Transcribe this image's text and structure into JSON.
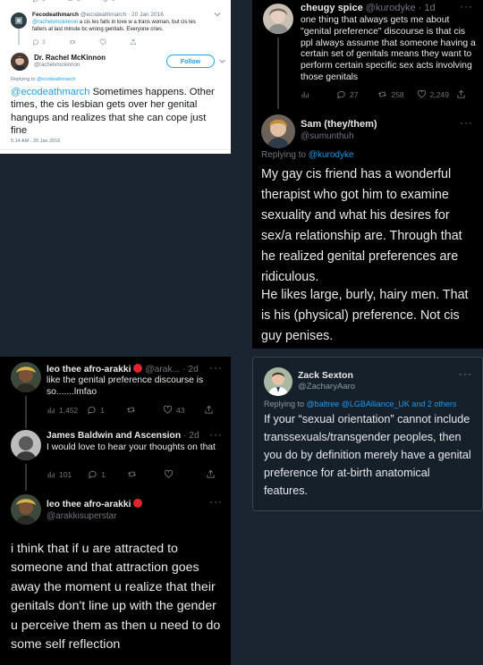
{
  "panel1": {
    "top_stats": [
      "0",
      "1",
      "3"
    ],
    "tweet1": {
      "name": "Fecodeathmarch",
      "handle": "@ecodeathmarch",
      "date": "20 Jan 2016",
      "reply_to": "@rachelvmckinnon",
      "text": "a cis les falls in love w a trans woman, but cis les falters at last minute bc wrong genitals. Everyone cries.",
      "stats": [
        "3",
        "",
        ""
      ]
    },
    "tweet2": {
      "name": "Dr. Rachel McKinnon",
      "handle": "@rachelvmckinnon",
      "follow_label": "Follow",
      "replying_label": "Replying to",
      "replying_handle": "@ecodeathmarch",
      "mention": "@ecodeathmarch",
      "text": " Sometimes happens. Other times, the cis lesbian gets over her genital hangups and realizes that she can cope just fine",
      "timestamp": "5:14 AM - 20 Jan 2016"
    }
  },
  "panel2": {
    "tweet1": {
      "name": "cheugy spice",
      "handle": "@kurodyke",
      "time": "1d",
      "text": "one thing that always gets me about \"genital preference\" discourse is that cis ppl always assume that someone having a certain set of genitals means they want to perform certain specific sex acts involving those genitals",
      "replies": "27",
      "retweets": "258",
      "likes": "2,249"
    },
    "tweet2": {
      "name": "Sam (they/them)",
      "handle": "@sumunthuh",
      "replying_label": "Replying to",
      "replying_handle": "@kurodyke",
      "para1": "My gay cis friend has a wonderful therapist who got him to examine sexuality and what his desires for sex/a relationship are. Through that he realized genital preferences are ridiculous.",
      "para2": "He likes large, burly, hairy men. That is his (physical) preference. Not cis guy penises."
    }
  },
  "panel3": {
    "tweet1": {
      "name": "leo thee afro-arakki",
      "handle": "@arak...",
      "time": "2d",
      "text": "like the genital preference discourse is so.......lmfao",
      "views": "1,452",
      "replies": "1",
      "likes": "43"
    },
    "tweet2": {
      "name": "James Baldwin and Ascension",
      "time": "2d",
      "text": "I would love to hear your thoughts on that",
      "views": "101",
      "replies": "1"
    },
    "tweet3": {
      "name": "leo thee afro-arakki",
      "handle": "@arakkisuperstar",
      "text": "i think that if u are attracted to someone and that attraction goes away the moment u realize that their genitals don't line up with the gender u perceive them as then u need to do some self reflection"
    }
  },
  "panel4": {
    "name": "Zack Sexton",
    "handle": "@ZacharyAaro",
    "replying_label": "Replying to",
    "replying_handles": "@baltree @LGBAlliance_UK and 2 others",
    "text": "If your “sexual orientation” cannot include transsexuals/transgender peoples, then you do by definition merely have a genital preference for at-birth anatomical features."
  },
  "colors": {
    "page_bg": "#1b2431",
    "black_panel": "#000000",
    "dim_panel": "#15202b",
    "accent_blue": "#1d9bf0",
    "legacy_blue": "#1da1f2",
    "like_red": "#f91880"
  },
  "icons": [
    "reply-icon",
    "retweet-icon",
    "like-icon",
    "share-icon",
    "views-icon",
    "more-icon",
    "chevron-down-icon",
    "red-circle-emoji"
  ]
}
